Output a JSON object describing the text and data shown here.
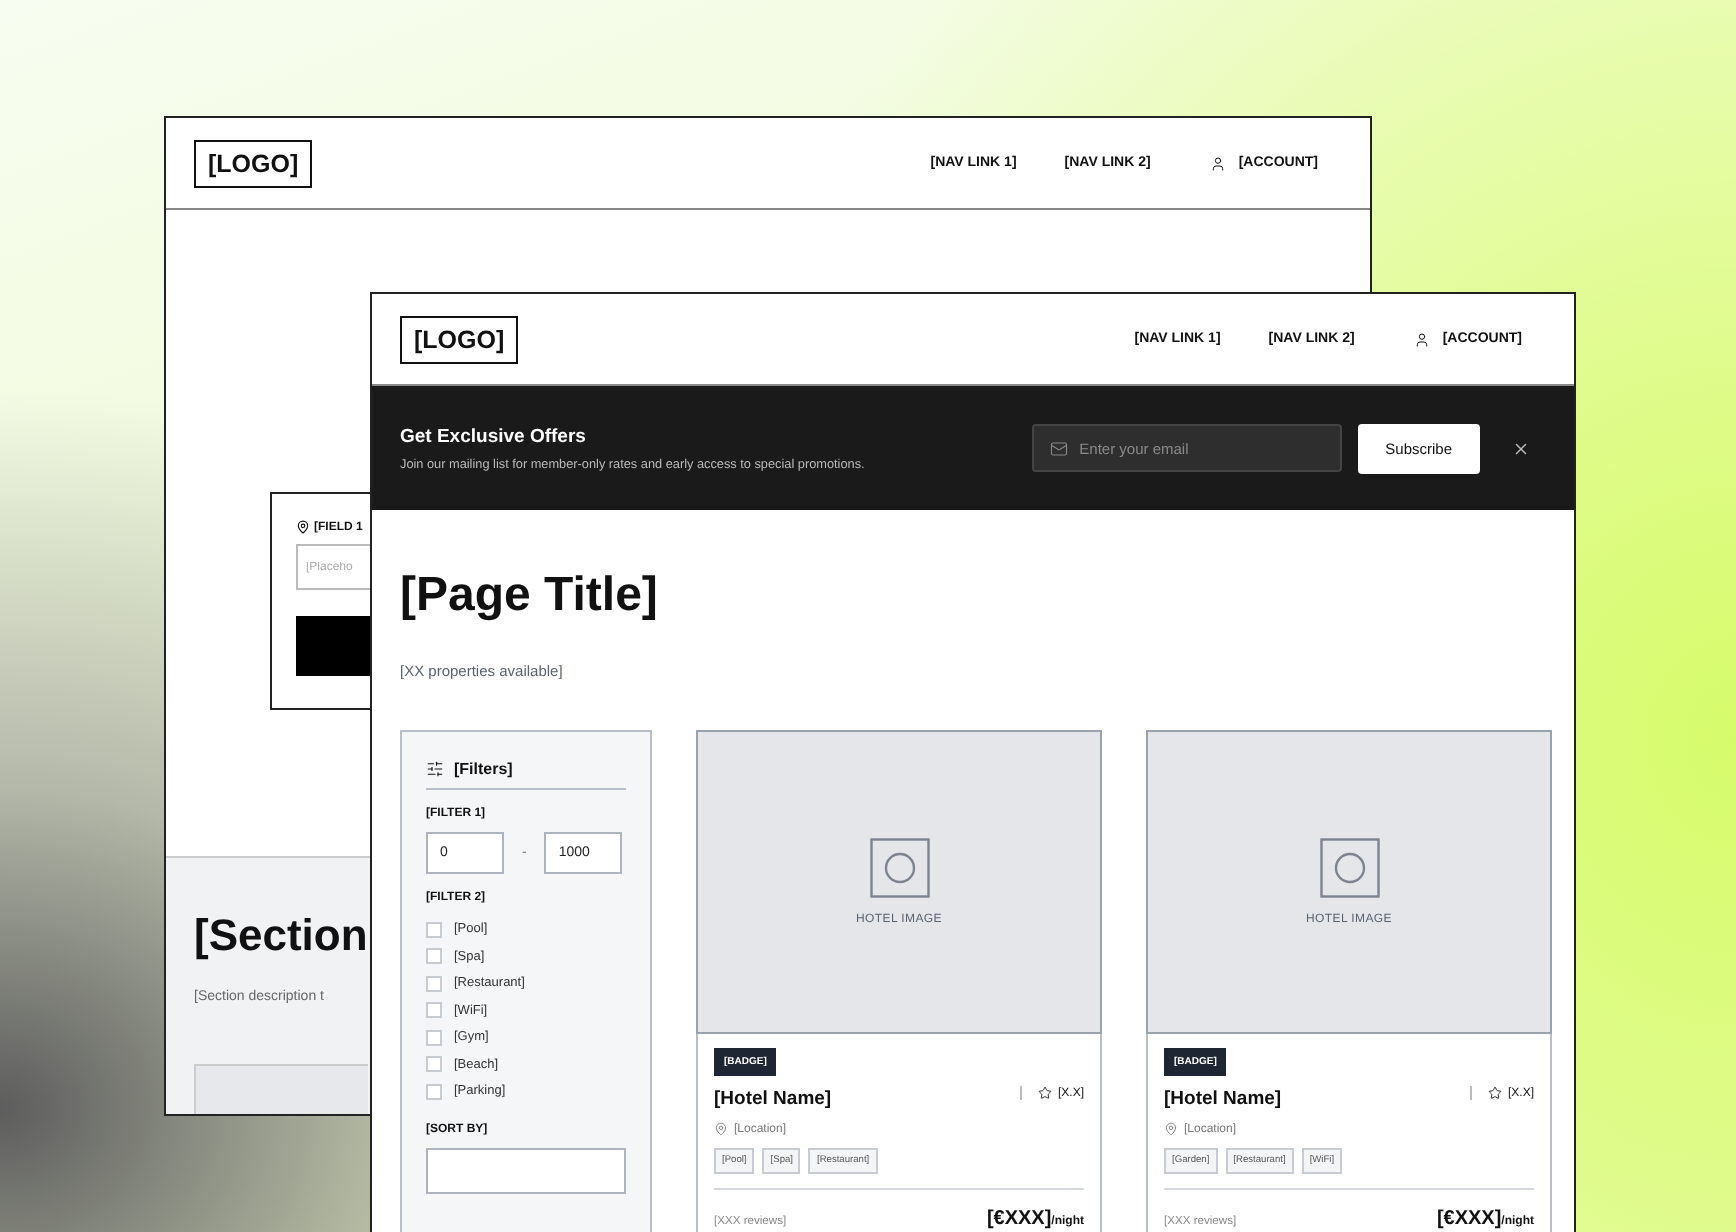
{
  "back_window": {
    "logo": "[LOGO]",
    "nav_links": [
      "[NAV LINK 1]",
      "[NAV LINK 2]"
    ],
    "account": "[ACCOUNT]",
    "search_card": {
      "field_label": "[FIELD 1",
      "placeholder": "[Placeho"
    },
    "section": {
      "title": "[Section",
      "description": "[Section description t"
    }
  },
  "front_window": {
    "logo": "[LOGO]",
    "nav_links": [
      "[NAV LINK 1]",
      "[NAV LINK 2]"
    ],
    "account": "[ACCOUNT]",
    "banner": {
      "title": "Get Exclusive Offers",
      "text": "Join our mailing list for member-only rates and early access to special promotions.",
      "email_placeholder": "Enter your email",
      "button": "Subscribe"
    },
    "page_title": "[Page Title]",
    "subtitle": "[XX properties available]",
    "filters": {
      "title": "[Filters]",
      "filter_1": {
        "label": "[FILTER 1]",
        "min": "0",
        "separator": "-",
        "max": "1000"
      },
      "filter_2": {
        "label": "[FILTER 2]",
        "options": [
          {
            "label": "[Pool]",
            "checked": false
          },
          {
            "label": "[Spa]",
            "checked": false
          },
          {
            "label": "[Restaurant]",
            "checked": false
          },
          {
            "label": "[WiFi]",
            "checked": false
          },
          {
            "label": "[Gym]",
            "checked": false
          },
          {
            "label": "[Beach]",
            "checked": false
          },
          {
            "label": "[Parking]",
            "checked": false
          }
        ]
      },
      "sort_by": {
        "label": "[SORT BY]"
      }
    },
    "hotels": [
      {
        "image_label": "HOTEL IMAGE",
        "badge": "[BADGE]",
        "name": "[Hotel Name]",
        "rating": "[X.X]",
        "location": "[Location]",
        "tags": [
          "[Pool]",
          "[Spa]",
          "[Restaurant]"
        ],
        "reviews": "[XXX reviews]",
        "price": "[€XXX]",
        "per": "/night"
      },
      {
        "image_label": "HOTEL IMAGE",
        "badge": "[BADGE]",
        "name": "[Hotel Name]",
        "rating": "[X.X]",
        "location": "[Location]",
        "tags": [
          "[Garden]",
          "[Restaurant]",
          "[WiFi]"
        ],
        "reviews": "[XXX reviews]",
        "price": "[€XXX]",
        "per": "/night"
      }
    ]
  }
}
